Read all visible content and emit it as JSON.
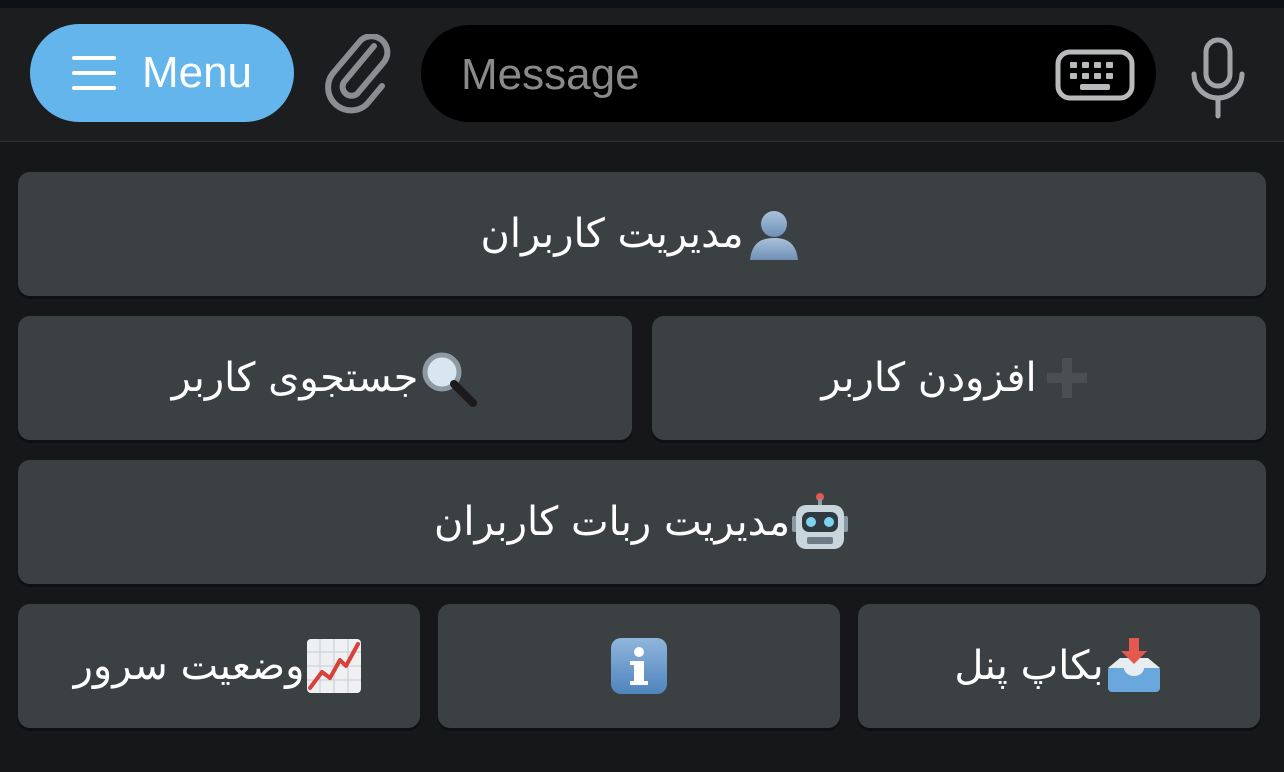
{
  "composer": {
    "menu_label": "Menu",
    "message_placeholder": "Message"
  },
  "keyboard": {
    "rows": [
      [
        {
          "label": "مدیریت کاربران",
          "icon": "person-silhouette-icon"
        }
      ],
      [
        {
          "label": "افزودن کاربر",
          "icon": "plus-icon"
        },
        {
          "label": "جستجوی کاربر",
          "icon": "magnifier-icon"
        }
      ],
      [
        {
          "label": "مدیریت ربات کاربران",
          "icon": "robot-icon"
        }
      ],
      [
        {
          "label": "بکاپ پنل",
          "icon": "inbox-tray-icon"
        },
        {
          "label": "",
          "icon": "information-icon"
        },
        {
          "label": "وضعیت سرور",
          "icon": "chart-increasing-icon"
        }
      ]
    ]
  },
  "colors": {
    "menu_button": "#64b5ec",
    "key_background": "#3b4042",
    "background": "#171819",
    "message_box": "#000000"
  }
}
